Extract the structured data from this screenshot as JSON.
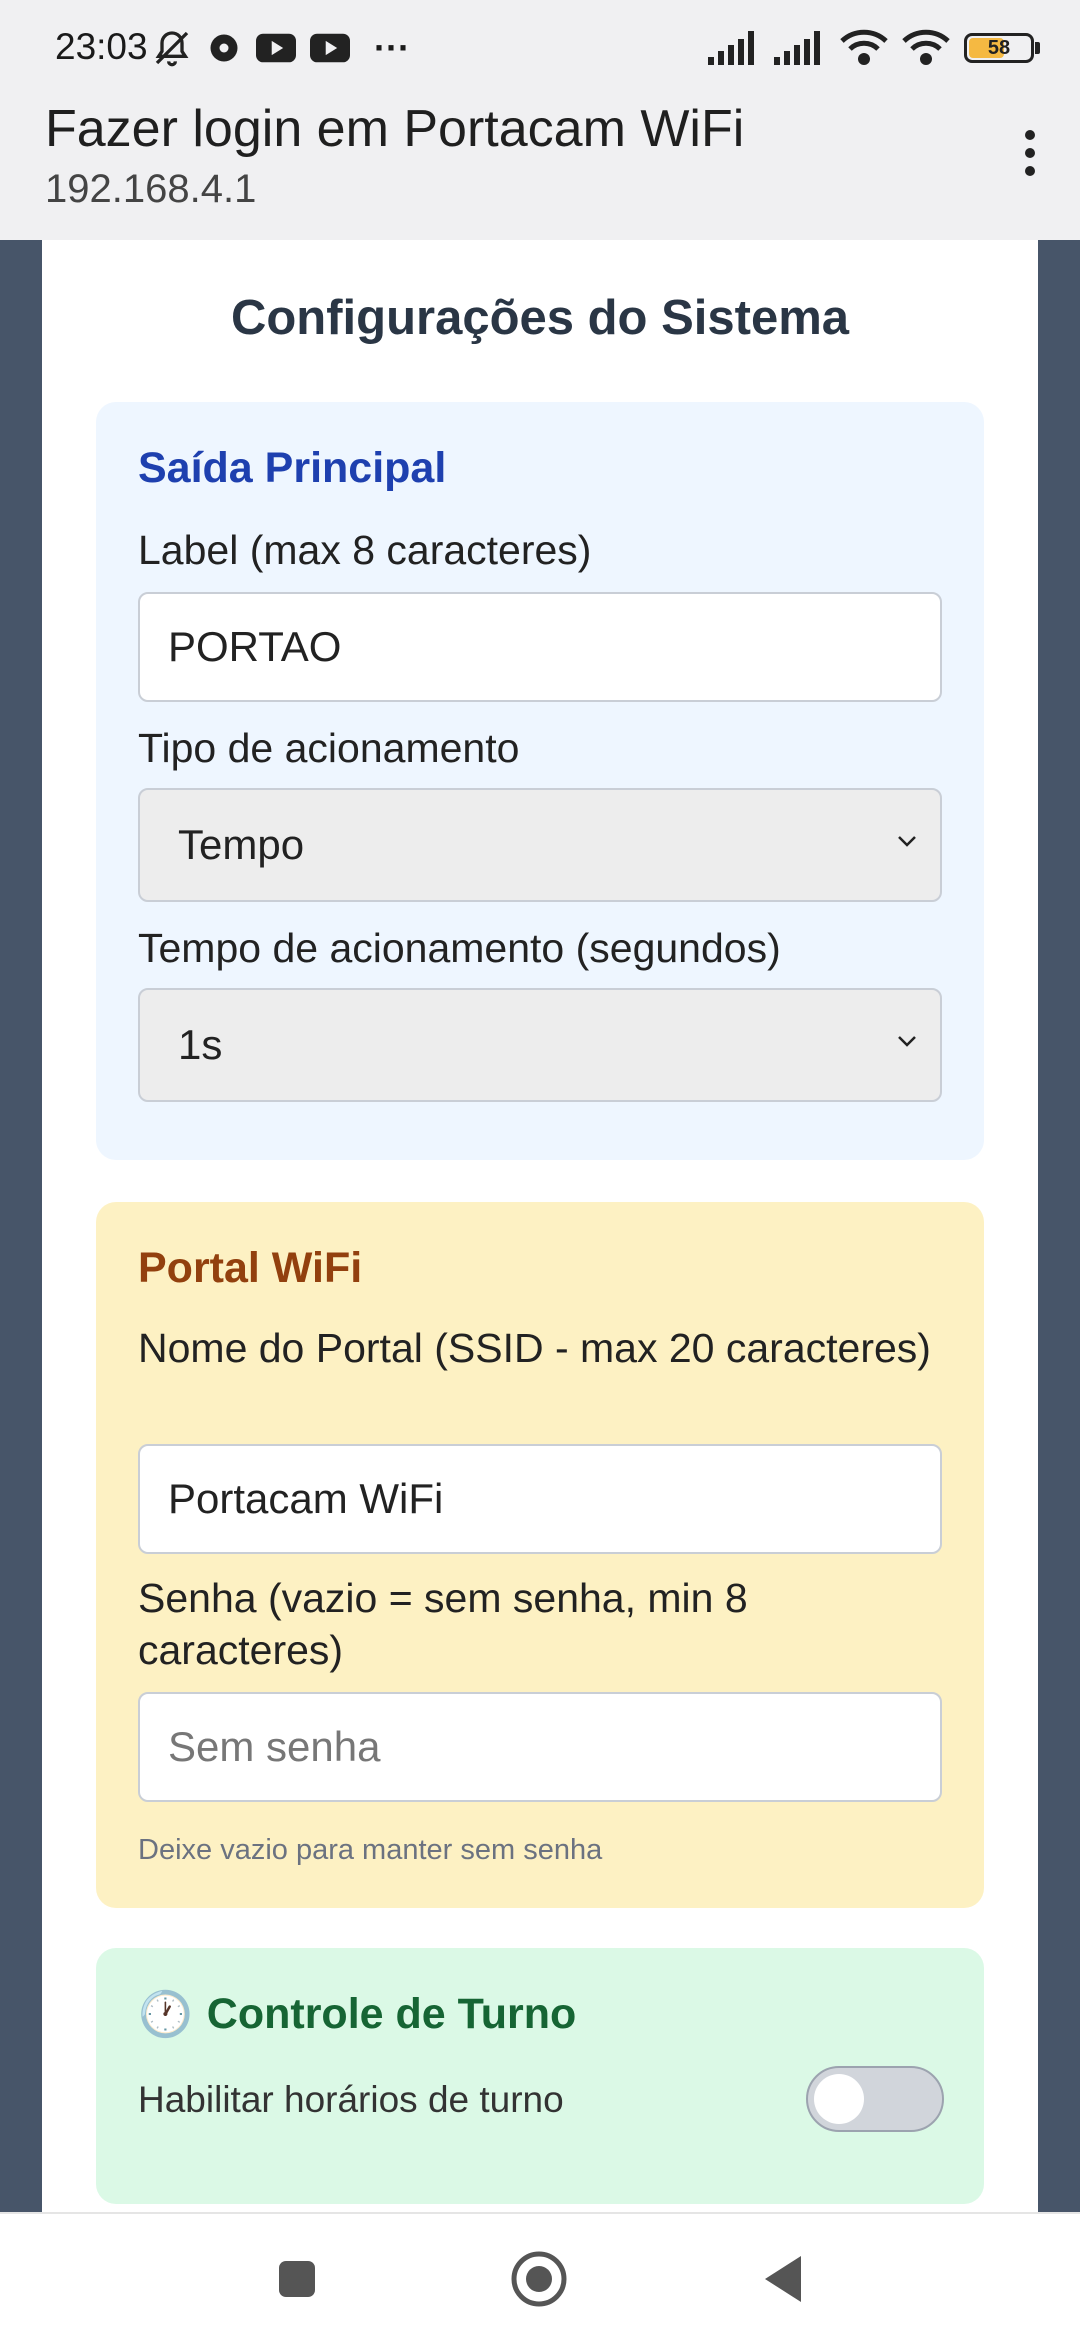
{
  "status_bar": {
    "time": "23:03",
    "left_icons": [
      "bell-off-icon",
      "chat-icon",
      "youtube-icon",
      "youtube-icon"
    ],
    "more": "···",
    "right_icons": [
      "signal-icon",
      "signal-icon",
      "wifi-link-icon",
      "wifi-icon"
    ],
    "battery": "58"
  },
  "browser": {
    "title": "Fazer login em Portacam WiFi",
    "url": "192.168.4.1"
  },
  "page": {
    "title": "Configurações do Sistema",
    "saida": {
      "heading": "Saída Principal",
      "label_caption": "Label (max 8 caracteres)",
      "label_value": "PORTAO",
      "tipo_caption": "Tipo de acionamento",
      "tipo_value": "Tempo",
      "tempo_caption": "Tempo de acionamento (segundos)",
      "tempo_value": "1s"
    },
    "portal": {
      "heading": "Portal WiFi",
      "ssid_caption": "Nome do Portal (SSID - max 20 caracteres)",
      "ssid_value": "Portacam WiFi",
      "senha_caption": "Senha (vazio = sem senha, min 8 caracteres)",
      "senha_placeholder": "Sem senha",
      "senha_hint": "Deixe vazio para manter sem senha"
    },
    "turno": {
      "icon": "🕐",
      "heading": "Controle de Turno",
      "toggle_label": "Habilitar horários de turno",
      "toggle_on": false
    }
  },
  "colors": {
    "blue_heading": "#1e40af",
    "brown_heading": "#92400e",
    "green_heading": "#166534"
  }
}
